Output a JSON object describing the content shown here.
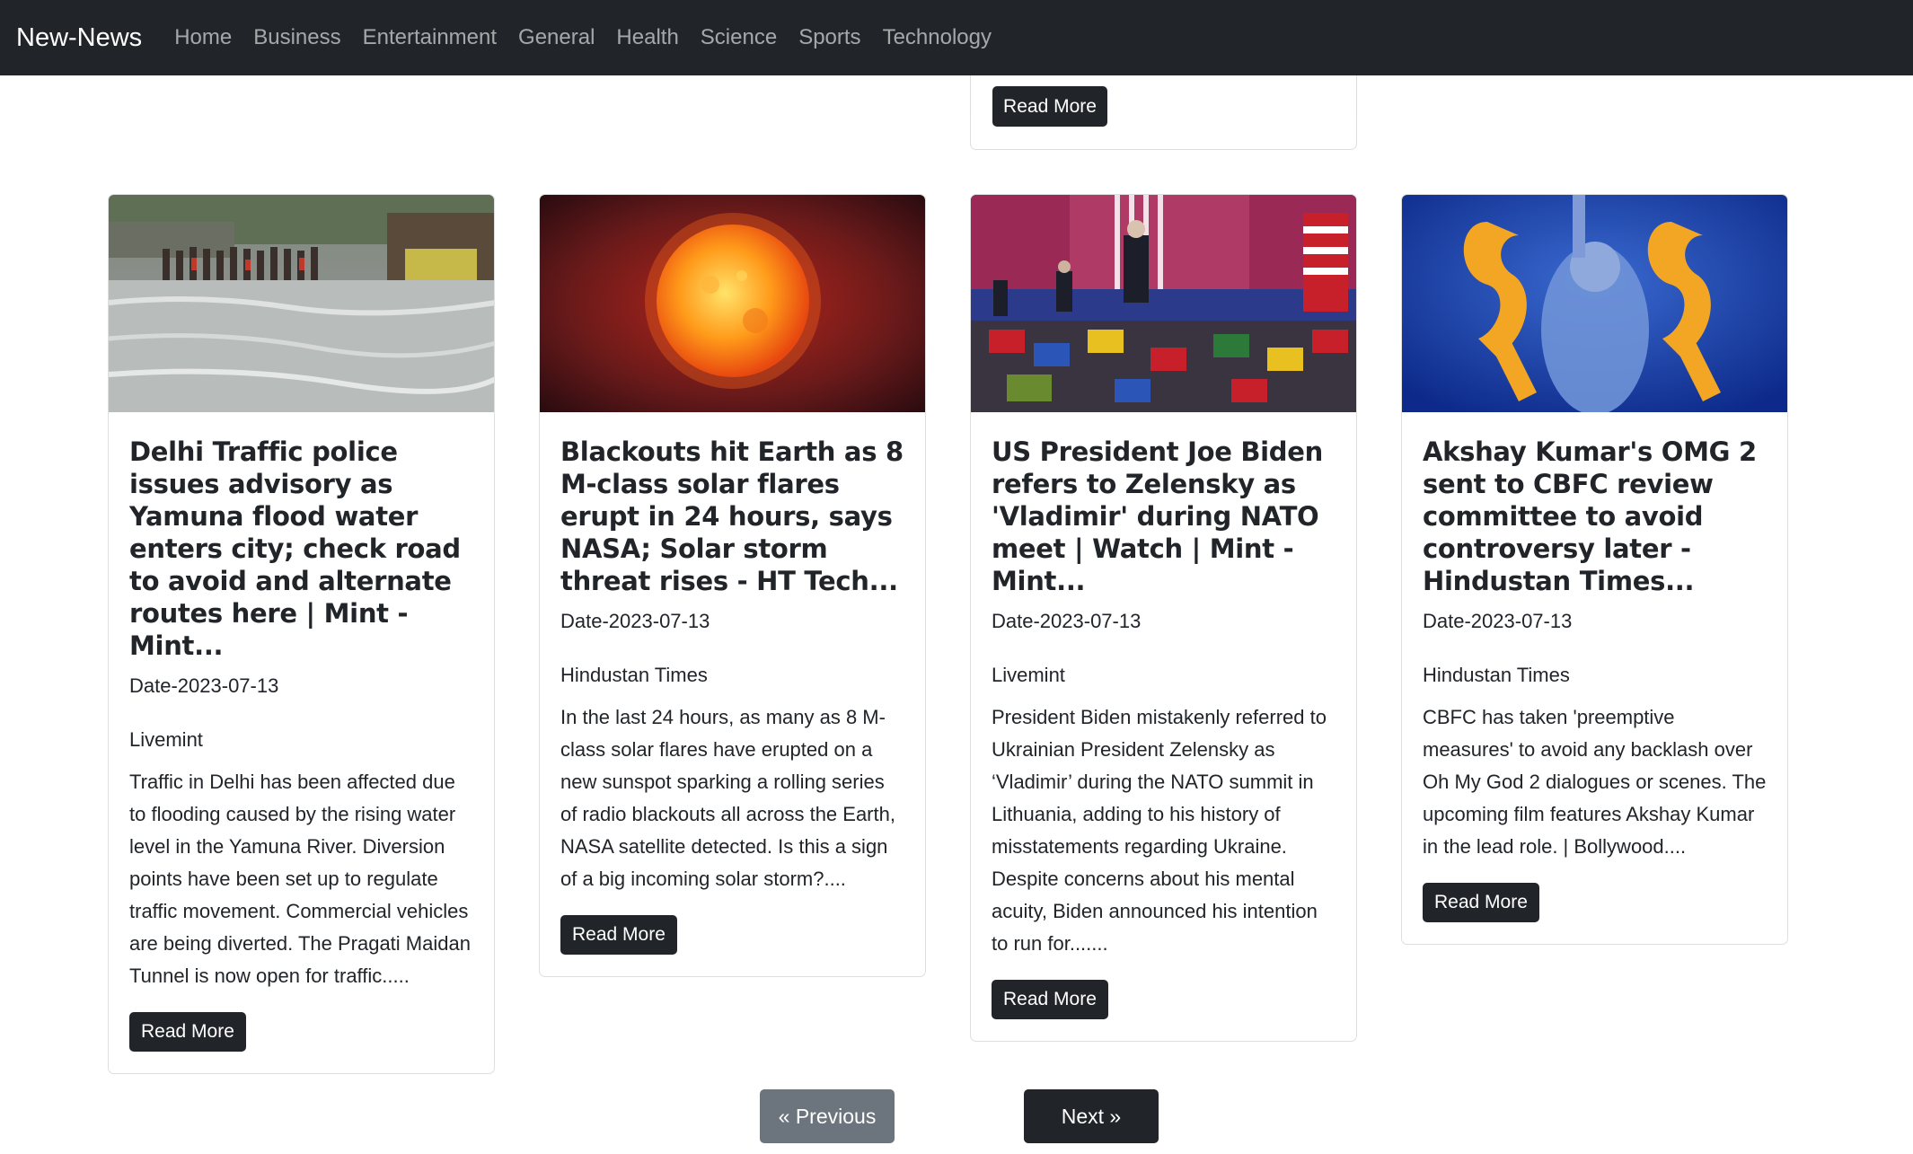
{
  "navbar": {
    "brand": "New-News",
    "links": [
      "Home",
      "Business",
      "Entertainment",
      "General",
      "Health",
      "Science",
      "Sports",
      "Technology"
    ]
  },
  "top_card": {
    "read_more": "Read More"
  },
  "cards": [
    {
      "title": "Delhi Traffic police issues advisory as Yamuna flood water enters city; check road to avoid and alternate routes here | Mint - Mint...",
      "date": "Date-2023-07-13",
      "source": "Livemint",
      "description": "Traffic in Delhi has been affected due to flooding caused by the rising water level in the Yamuna River. Diversion points have been set up to regulate traffic movement. Commercial vehicles are being diverted. The Pragati Maidan Tunnel is now open for traffic.....",
      "read_more": "Read More",
      "image": "flood-photo"
    },
    {
      "title": "Blackouts hit Earth as 8 M-class solar flares erupt in 24 hours, says NASA; Solar storm threat rises - HT Tech...",
      "date": "Date-2023-07-13",
      "source": "Hindustan Times",
      "description": "In the last 24 hours, as many as 8 M-class solar flares have erupted on a new sunspot sparking a rolling series of radio blackouts all across the Earth, NASA satellite detected. Is this a sign of a big incoming solar storm?....",
      "read_more": "Read More",
      "image": "sun-photo"
    },
    {
      "title": "US President Joe Biden refers to Zelensky as 'Vladimir' during NATO meet | Watch | Mint - Mint...",
      "date": "Date-2023-07-13",
      "source": "Livemint",
      "description": "President Biden mistakenly referred to Ukrainian President Zelensky as ‘Vladimir’ during the NATO summit in Lithuania, adding to his history of misstatements regarding Ukraine. Despite concerns about his mental acuity, Biden announced his intention to run for.......",
      "read_more": "Read More",
      "image": "rally-photo"
    },
    {
      "title": "Akshay Kumar's OMG 2 sent to CBFC review committee to avoid controversy later - Hindustan Times...",
      "date": "Date-2023-07-13",
      "source": "Hindustan Times",
      "description": "CBFC has taken 'preemptive measures' to avoid any backlash over Oh My God 2 dialogues or scenes. The upcoming film features Akshay Kumar in the lead role. | Bollywood....",
      "read_more": "Read More",
      "image": "poster-photo"
    }
  ],
  "pagination": {
    "previous": "« Previous",
    "next": "Next »"
  }
}
